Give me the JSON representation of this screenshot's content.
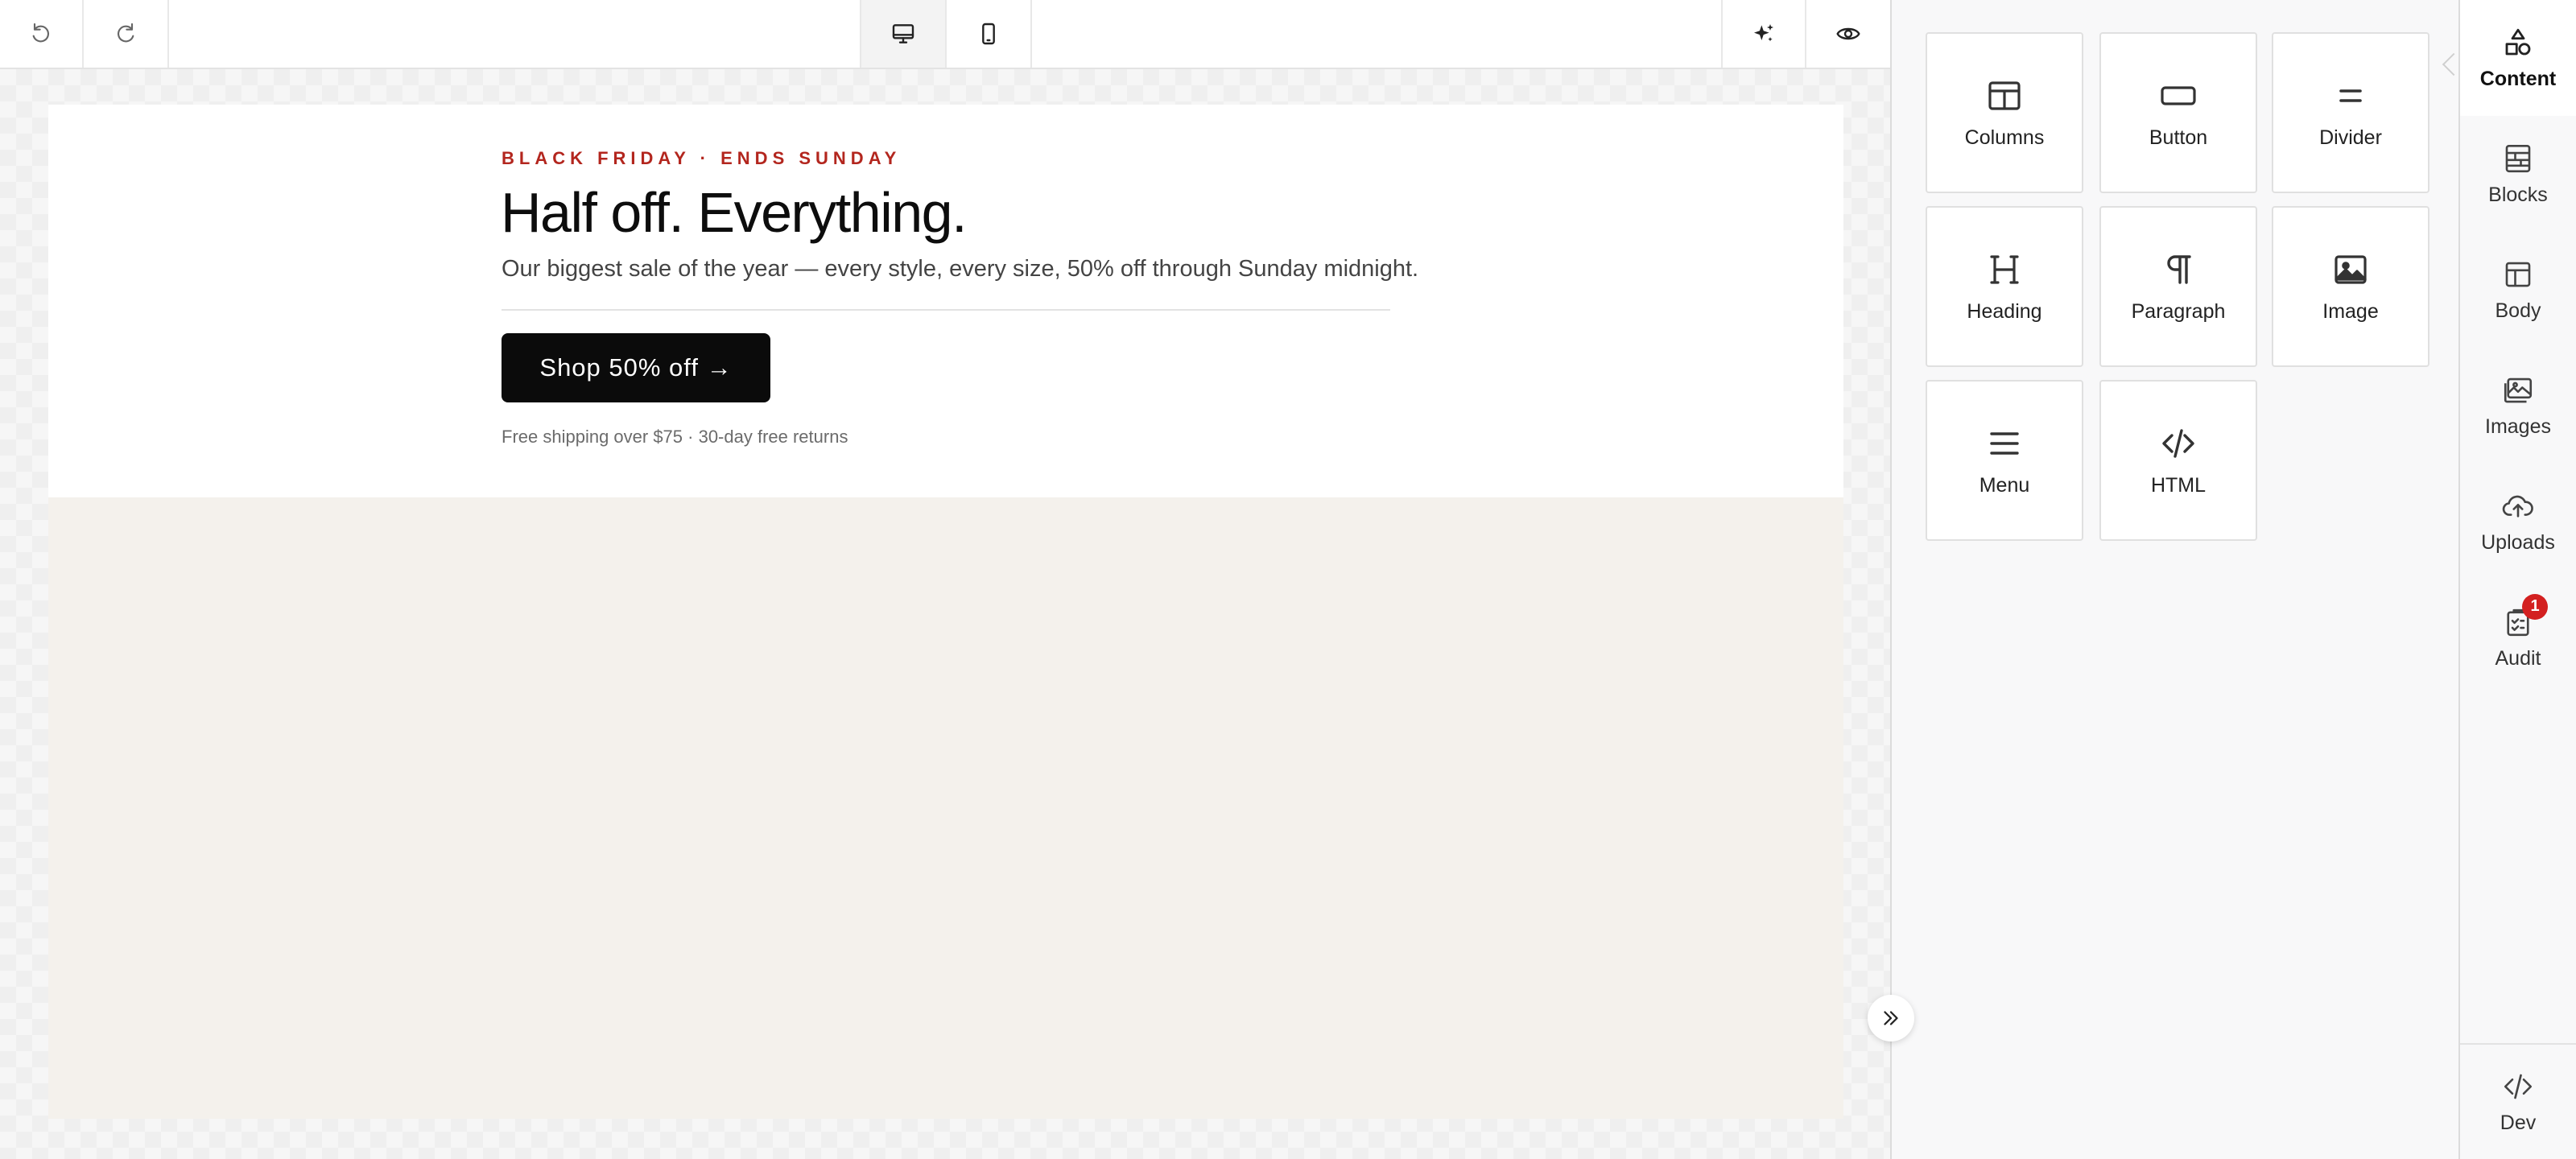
{
  "toolbar": {
    "undo_icon": "undo-icon",
    "redo_icon": "redo-icon",
    "desktop_icon": "desktop-icon",
    "mobile_icon": "mobile-icon",
    "ai_icon": "sparkle-icon",
    "preview_icon": "eye-icon",
    "active_view": "desktop"
  },
  "email": {
    "eyebrow": "BLACK FRIDAY · ENDS SUNDAY",
    "headline": "Half off. Everything.",
    "subtext": "Our biggest sale of the year — every style, every size, 50% off through Sunday midnight.",
    "cta_label": "Shop 50% off →",
    "fineprint": "Free shipping over $75 · 30-day free returns",
    "colors": {
      "eyebrow": "#b3261e",
      "cta_bg": "#0b0b0b",
      "body_bg": "#f4f1ec"
    }
  },
  "content_tools": [
    {
      "label": "Columns",
      "icon": "columns-icon"
    },
    {
      "label": "Button",
      "icon": "button-icon"
    },
    {
      "label": "Divider",
      "icon": "divider-icon"
    },
    {
      "label": "Heading",
      "icon": "heading-icon"
    },
    {
      "label": "Paragraph",
      "icon": "paragraph-icon"
    },
    {
      "label": "Image",
      "icon": "image-icon"
    },
    {
      "label": "Menu",
      "icon": "menu-icon"
    },
    {
      "label": "HTML",
      "icon": "code-icon"
    }
  ],
  "sidebar": {
    "items": [
      {
        "label": "Content",
        "icon": "shapes-icon",
        "active": true
      },
      {
        "label": "Blocks",
        "icon": "blocks-icon"
      },
      {
        "label": "Body",
        "icon": "layout-icon"
      },
      {
        "label": "Images",
        "icon": "images-icon"
      },
      {
        "label": "Uploads",
        "icon": "cloud-upload-icon"
      },
      {
        "label": "Audit",
        "icon": "clipboard-check-icon",
        "badge": "1"
      }
    ],
    "dev": {
      "label": "Dev",
      "icon": "code-icon"
    }
  },
  "collapse_icon": "chevrons-right-icon"
}
